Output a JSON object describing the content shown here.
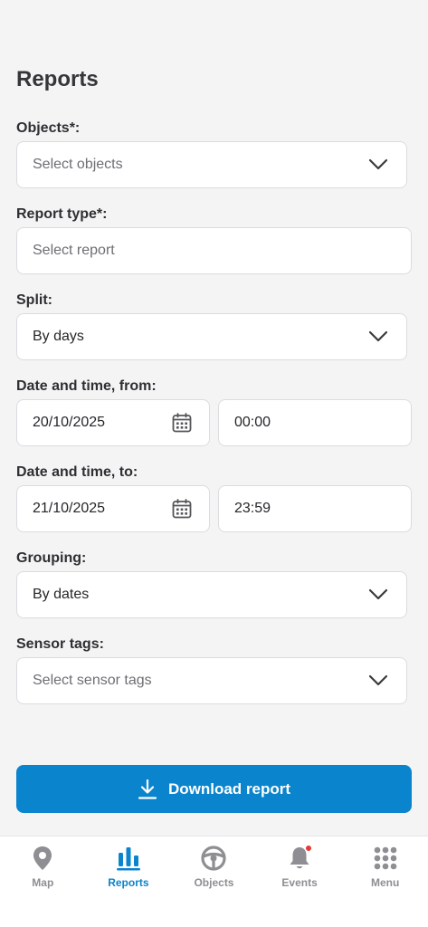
{
  "header": {
    "title": "Reports"
  },
  "form": {
    "objects": {
      "label": "Objects*:",
      "placeholder": "Select objects"
    },
    "report_type": {
      "label": "Report type*:",
      "placeholder": "Select report"
    },
    "split": {
      "label": "Split:",
      "value": "By days"
    },
    "from": {
      "label": "Date and time, from:",
      "date": "20/10/2025",
      "time": "00:00"
    },
    "to": {
      "label": "Date and time, to:",
      "date": "21/10/2025",
      "time": "23:59"
    },
    "grouping": {
      "label": "Grouping:",
      "value": "By dates"
    },
    "sensor_tags": {
      "label": "Sensor tags:",
      "placeholder": "Select sensor tags"
    }
  },
  "download_button": {
    "label": "Download report"
  },
  "tabbar": {
    "items": [
      {
        "label": "Map",
        "icon": "map-pin-icon",
        "active": false
      },
      {
        "label": "Reports",
        "icon": "bar-chart-icon",
        "active": true
      },
      {
        "label": "Objects",
        "icon": "steering-wheel-icon",
        "active": false
      },
      {
        "label": "Events",
        "icon": "bell-icon",
        "active": false,
        "badge": true
      },
      {
        "label": "Menu",
        "icon": "grid-icon",
        "active": false
      }
    ]
  },
  "colors": {
    "accent": "#0a84cc",
    "background": "#f4f4f5",
    "badge": "#e53935",
    "inactive": "#8e8e93"
  }
}
